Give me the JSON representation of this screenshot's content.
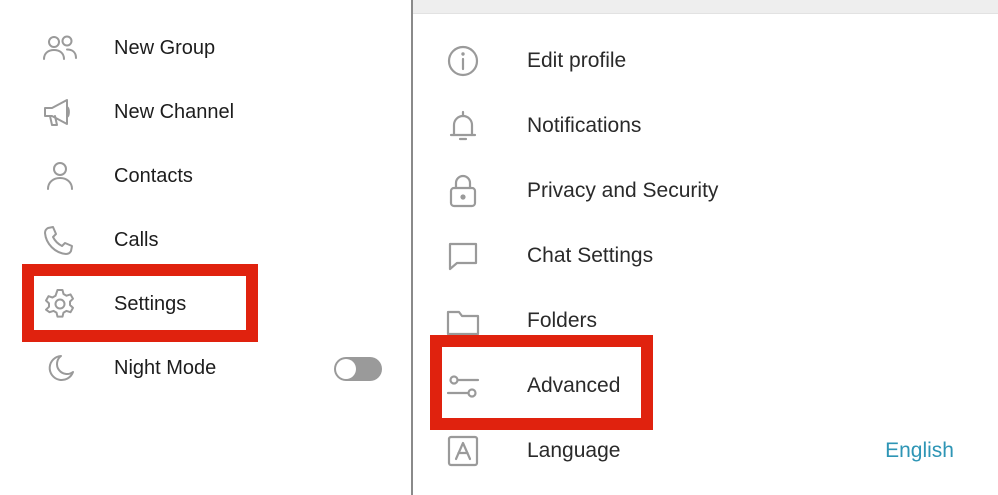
{
  "left_menu": {
    "items": [
      {
        "label": "New Group",
        "icon": "group-icon"
      },
      {
        "label": "New Channel",
        "icon": "megaphone-icon"
      },
      {
        "label": "Contacts",
        "icon": "person-icon"
      },
      {
        "label": "Calls",
        "icon": "phone-icon"
      },
      {
        "label": "Settings",
        "icon": "gear-icon"
      },
      {
        "label": "Night Mode",
        "icon": "moon-icon"
      }
    ],
    "night_mode_enabled": false
  },
  "settings_menu": {
    "items": [
      {
        "label": "Edit profile",
        "icon": "info-icon"
      },
      {
        "label": "Notifications",
        "icon": "bell-icon"
      },
      {
        "label": "Privacy and Security",
        "icon": "lock-icon"
      },
      {
        "label": "Chat Settings",
        "icon": "chat-bubble-icon"
      },
      {
        "label": "Folders",
        "icon": "folder-icon"
      },
      {
        "label": "Advanced",
        "icon": "sliders-icon"
      },
      {
        "label": "Language",
        "icon": "language-icon",
        "value": "English"
      }
    ]
  },
  "colors": {
    "highlight": "#e0220e",
    "accent": "#2e95b5",
    "icon": "#9a9a9a",
    "text": "#1d1d1d"
  }
}
